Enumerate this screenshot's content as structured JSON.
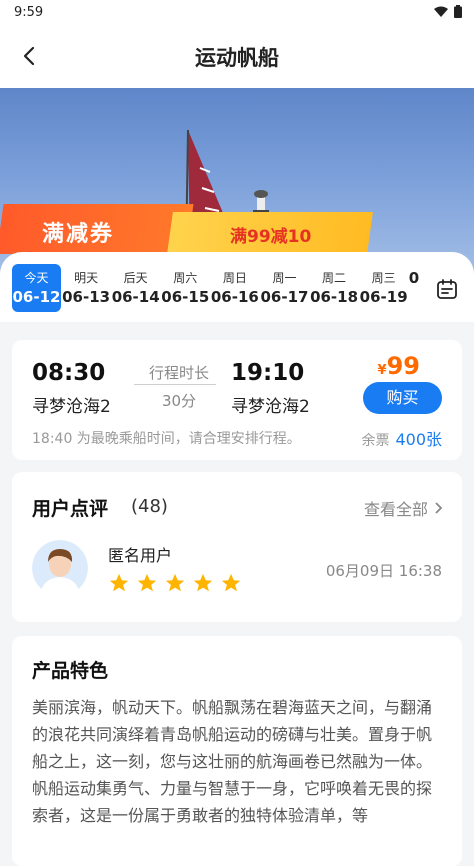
{
  "status": {
    "time": "9:59"
  },
  "nav": {
    "title": "运动帆船"
  },
  "banner": {
    "coupon_label": "满减券",
    "coupon_offer": "满99减10"
  },
  "dates": [
    {
      "weekday": "今天",
      "date": "06-12",
      "active": true
    },
    {
      "weekday": "明天",
      "date": "06-13"
    },
    {
      "weekday": "后天",
      "date": "06-14"
    },
    {
      "weekday": "周六",
      "date": "06-15"
    },
    {
      "weekday": "周日",
      "date": "06-16"
    },
    {
      "weekday": "周一",
      "date": "06-17"
    },
    {
      "weekday": "周二",
      "date": "06-18"
    },
    {
      "weekday": "周三",
      "date": "06-19"
    },
    {
      "weekday": "",
      "date": "0"
    }
  ],
  "trip": {
    "depart_time": "08:30",
    "depart_port": "寻梦沧海2",
    "duration_label": "行程时长",
    "duration": "30分",
    "arrive_time": "19:10",
    "arrive_port": "寻梦沧海2",
    "currency": "¥",
    "price": "99",
    "buy_label": "购买",
    "notice": "18:40 为最晚乘船时间，请合理安排行程。",
    "remain_label": "余票",
    "remain_count": "400张"
  },
  "reviews": {
    "title": "用户点评",
    "count": "(48)",
    "view_all": "查看全部",
    "items": [
      {
        "user": "匿名用户",
        "rating": 5,
        "date": "06月09日 16:38"
      }
    ]
  },
  "features": {
    "title": "产品特色",
    "text": "美丽滨海，帆动天下。帆船飘荡在碧海蓝天之间，与翻涌的浪花共同演绎着青岛帆船运动的磅礴与壮美。置身于帆船之上，这一刻，您与这壮丽的航海画卷已然融为一体。\n帆船运动集勇气、力量与智慧于一身，它呼唤着无畏的探索者，这是一份属于勇敢者的独特体验清单，等"
  },
  "colors": {
    "accent": "#1a7cf3",
    "price": "#ff6a00",
    "star": "#ffb400"
  }
}
